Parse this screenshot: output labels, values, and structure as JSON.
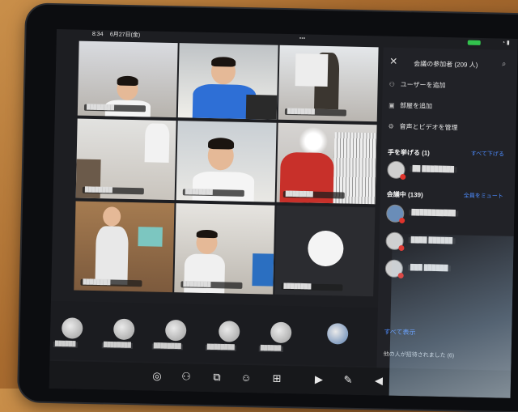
{
  "status_bar": {
    "time": "8:34",
    "date": "6月27日(金)",
    "dots": "•••"
  },
  "panel": {
    "title": "会議の参加者 (209 人)",
    "actions": [
      {
        "icon": "add-user-icon",
        "label": "ユーザーを追加"
      },
      {
        "icon": "add-room-icon",
        "label": "部屋を追加"
      },
      {
        "icon": "gear-icon",
        "label": "音声とビデオを管理"
      }
    ],
    "raised_hands": {
      "title": "手を挙げる (1)",
      "action": "すべて下げる"
    },
    "in_meeting": {
      "title": "会議中 (139)",
      "action": "全員をミュート"
    },
    "show_all": "すべて表示",
    "others": "他の人が招待されました (6)"
  },
  "grid_tiles": [
    {
      "label": "████████"
    },
    {
      "label": "████████"
    },
    {
      "label": "████████"
    },
    {
      "label": "████████"
    },
    {
      "label": "████████"
    },
    {
      "label": "████████"
    },
    {
      "label": "████████"
    },
    {
      "label": "████████"
    },
    {
      "label": "████████"
    }
  ],
  "strip": [
    {
      "label": "██████"
    },
    {
      "label": "████████"
    },
    {
      "label": "████████"
    },
    {
      "label": "████████"
    },
    {
      "label": "██████"
    },
    {
      "label": ""
    }
  ],
  "members": [
    {
      "label": "██ ████████"
    },
    {
      "label": "███████████"
    },
    {
      "label": "████ ██████"
    },
    {
      "label": "███ ██████"
    }
  ],
  "toolbar": [
    "chat-icon",
    "participants-icon",
    "share-icon",
    "reactions-icon",
    "apps-icon",
    "camera-icon",
    "mic-off-icon",
    "speaker-icon"
  ],
  "colors": {
    "accent": "#4d8cff",
    "record": "#e0342c",
    "battery": "#32c24d"
  }
}
